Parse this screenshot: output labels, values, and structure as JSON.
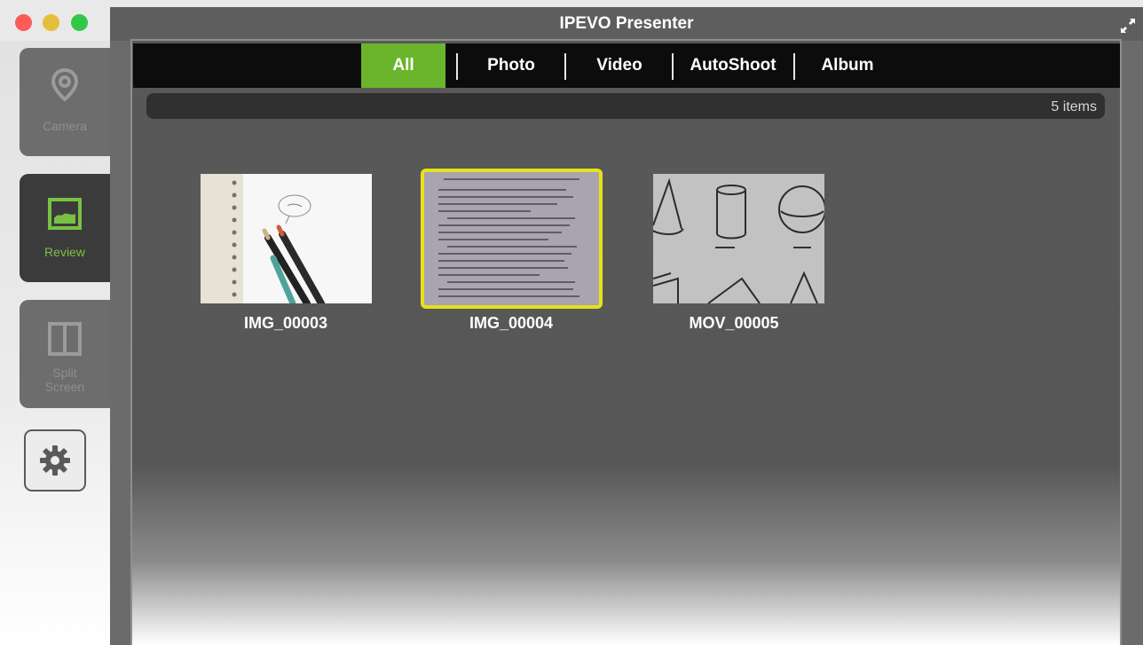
{
  "window": {
    "title": "IPEVO Presenter"
  },
  "sidebar": {
    "items": [
      {
        "label": "Camera",
        "icon": "location-pin-icon",
        "active": false
      },
      {
        "label": "Review",
        "icon": "image-icon",
        "active": true
      },
      {
        "label": "Split\nScreen",
        "icon": "split-screen-icon",
        "active": false
      }
    ],
    "settings_icon": "gear-icon"
  },
  "filters": {
    "tabs": [
      {
        "label": "All",
        "active": true
      },
      {
        "label": "Photo",
        "active": false
      },
      {
        "label": "Video",
        "active": false
      },
      {
        "label": "AutoShoot",
        "active": false
      },
      {
        "label": "Album",
        "active": false
      }
    ]
  },
  "gallery": {
    "count_label": "5 items",
    "items": [
      {
        "name": "IMG_00003",
        "selected": false
      },
      {
        "name": "IMG_00004",
        "selected": true
      },
      {
        "name": "MOV_00005",
        "selected": false
      }
    ]
  },
  "colors": {
    "accent_green": "#6bb52d",
    "selection_yellow": "#e5e21a",
    "close": "#fc5b57",
    "minimize": "#e5bf3c",
    "zoom": "#33c748"
  }
}
